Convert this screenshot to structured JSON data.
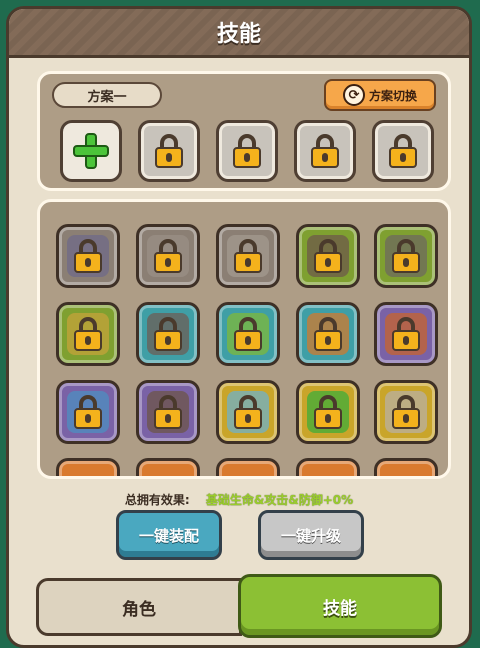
{
  "header": {
    "title": "技能"
  },
  "loadout": {
    "plan_label": "方案一",
    "switch_label": "方案切换",
    "switch_icon": "refresh-icon",
    "slots": [
      "add",
      "locked",
      "locked",
      "locked",
      "locked"
    ]
  },
  "skills": {
    "rows": [
      [
        {
          "frame": "#8b7f74",
          "art": "#6f6a88",
          "locked": true
        },
        {
          "frame": "#8b7f74",
          "art": "#9a8f85",
          "locked": true
        },
        {
          "frame": "#8b7f74",
          "art": "#a39a8f",
          "locked": true
        },
        {
          "frame": "#7fa030",
          "art": "#6e5a4a",
          "locked": true
        },
        {
          "frame": "#7fa030",
          "art": "#6e6a5e",
          "locked": true
        }
      ],
      [
        {
          "frame": "#7fa030",
          "art": "#c4a33a",
          "locked": true
        },
        {
          "frame": "#3f9fa6",
          "art": "#6e5e55",
          "locked": true
        },
        {
          "frame": "#3f9fa6",
          "art": "#7fb83a",
          "locked": true
        },
        {
          "frame": "#3f9fa6",
          "art": "#d0792e",
          "locked": true
        },
        {
          "frame": "#7a62a6",
          "art": "#c7642e",
          "locked": true
        }
      ],
      [
        {
          "frame": "#7a62a6",
          "art": "#4d8fc0",
          "locked": true
        },
        {
          "frame": "#7a62a6",
          "art": "#6e5648",
          "locked": true
        },
        {
          "frame": "#c9a52a",
          "art": "#6fb2c8",
          "locked": true
        },
        {
          "frame": "#c9a52a",
          "art": "#3fae3a",
          "locked": true
        },
        {
          "frame": "#c9a52a",
          "art": "#b8b0a2",
          "locked": true
        }
      ]
    ]
  },
  "effect": {
    "label": "总拥有效果:",
    "value": "基础生命&攻击&防御+0%"
  },
  "actions": {
    "equip_label": "一键装配",
    "upgrade_label": "一键升级"
  },
  "tabs": {
    "role_label": "角色",
    "skill_label": "技能"
  }
}
